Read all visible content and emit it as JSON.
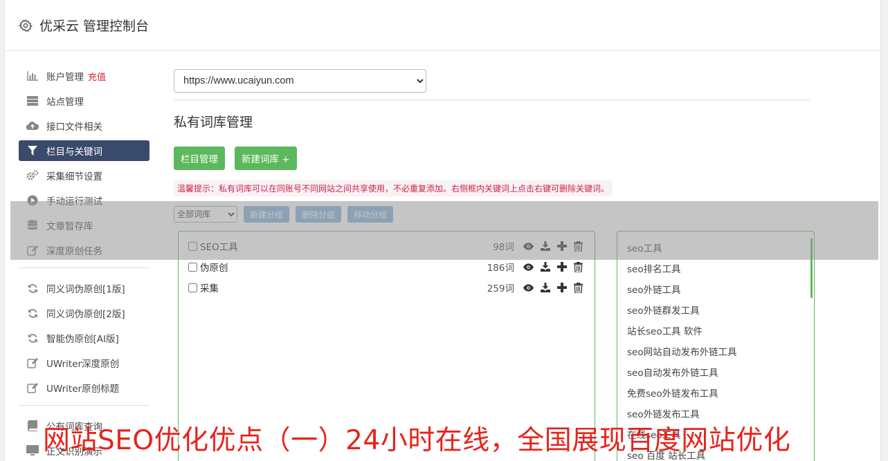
{
  "header": {
    "title": "优采云 管理控制台",
    "icon": "gear-icon"
  },
  "sidebar": {
    "items": [
      {
        "label": "账户管理",
        "badge": "充值",
        "icon": "bar-chart-icon",
        "active": false
      },
      {
        "label": "站点管理",
        "icon": "server-icon",
        "active": false
      },
      {
        "label": "接口文件相关",
        "icon": "cloud-upload-icon",
        "active": false
      },
      {
        "label": "栏目与关键词",
        "icon": "filter-icon",
        "active": true
      },
      {
        "label": "采集细节设置",
        "icon": "cogs-icon",
        "active": false
      },
      {
        "label": "手动运行测试",
        "icon": "play-circle-icon",
        "active": false
      },
      {
        "label": "文章暂存库",
        "icon": "database-icon",
        "active": false
      },
      {
        "label": "深度原创任务",
        "icon": "edit-icon",
        "active": false
      }
    ],
    "items2": [
      {
        "label": "同义词伪原创[1版]",
        "icon": "refresh-icon"
      },
      {
        "label": "同义词伪原创[2版]",
        "icon": "refresh-icon"
      },
      {
        "label": "智能伪原创[AI版]",
        "icon": "refresh-icon"
      },
      {
        "label": "UWriter深度原创",
        "icon": "edit-icon"
      },
      {
        "label": "UWriter原创标题",
        "icon": "edit-icon"
      }
    ],
    "items3": [
      {
        "label": "公有词库查询",
        "icon": "book-icon"
      },
      {
        "label": "正文识别演示",
        "icon": "monitor-icon"
      }
    ]
  },
  "main": {
    "site_select": {
      "value": "https://www.ucaiyun.com",
      "options": [
        "https://www.ucaiyun.com"
      ]
    },
    "section_title": "私有词库管理",
    "buttons": {
      "column_manage": "栏目管理",
      "new_library": "新建词库 +"
    },
    "tip": "温馨提示：私有词库可以在同账号不同网站之间共享使用，不必重复添加。右侧框内关键词上点击右键可删除关键词。",
    "toolbar": {
      "filter_select": {
        "value": "全部词库",
        "options": [
          "全部词库"
        ]
      },
      "new_group": "新建分组",
      "delete_group": "删除分组",
      "move_group": "移动分组"
    },
    "libraries": [
      {
        "name": "SEO工具",
        "count": "98词"
      },
      {
        "name": "伪原创",
        "count": "186词"
      },
      {
        "name": "采集",
        "count": "259词"
      }
    ],
    "keywords": [
      "seo工具",
      "seo排名工具",
      "seo外链工具",
      "seo外链群发工具",
      "站长seo工具 软件",
      "seo网站自动发布外链工具",
      "seo自动发布外链工具",
      "免费seo外链发布工具",
      "seo外链发布工具",
      "在线seo工具",
      "seo 百度 站长工具"
    ]
  },
  "banner": "网站SEO优化优点（一）24小时在线，全国展现百度网站优化"
}
